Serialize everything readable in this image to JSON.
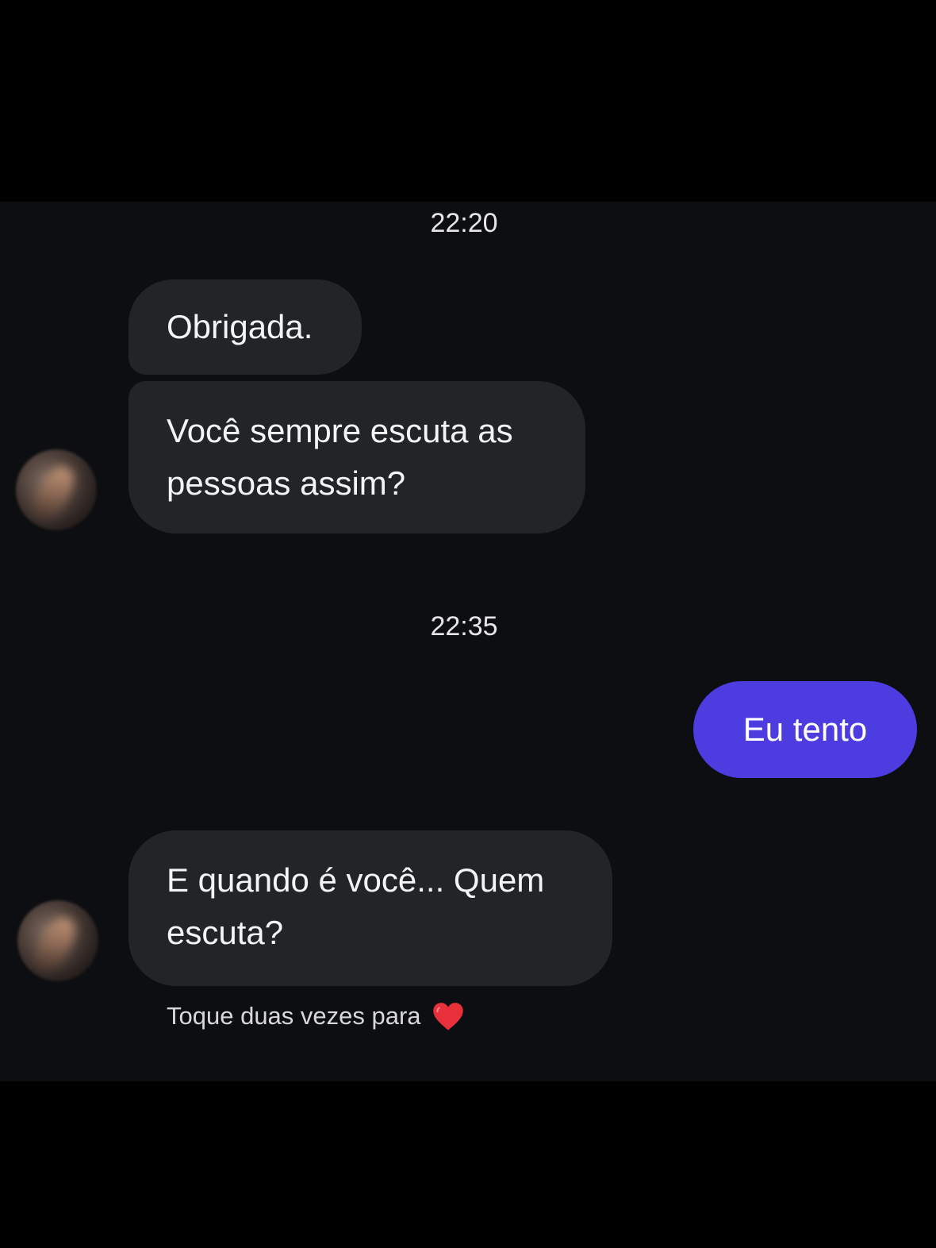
{
  "messages": {
    "timestamp_1": "22:20",
    "incoming_1": "Obrigada.",
    "incoming_2": "Você sempre escuta as pessoas assim?",
    "timestamp_2": "22:35",
    "outgoing_1": "Eu tento",
    "incoming_3": "E quando é você... Quem escuta?"
  },
  "hint": {
    "text": "Toque duas vezes para",
    "icon": "heart-icon"
  },
  "colors": {
    "background": "#0c0e11",
    "incoming_bubble": "#222528",
    "outgoing_bubble": "#4d3ce0",
    "heart": "#e8303a"
  }
}
